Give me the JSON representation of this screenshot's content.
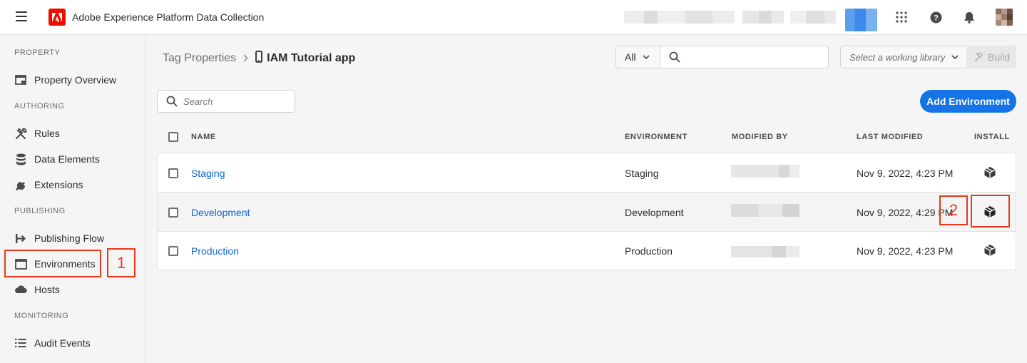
{
  "app": {
    "title": "Adobe Experience Platform Data Collection"
  },
  "sidebar": {
    "sections": [
      {
        "heading": "PROPERTY",
        "items": [
          {
            "label": "Property Overview",
            "icon": "property-overview-icon"
          }
        ]
      },
      {
        "heading": "AUTHORING",
        "items": [
          {
            "label": "Rules",
            "icon": "rules-icon"
          },
          {
            "label": "Data Elements",
            "icon": "data-elements-icon"
          },
          {
            "label": "Extensions",
            "icon": "extensions-icon"
          }
        ]
      },
      {
        "heading": "PUBLISHING",
        "items": [
          {
            "label": "Publishing Flow",
            "icon": "publishing-flow-icon"
          },
          {
            "label": "Environments",
            "icon": "environments-icon"
          },
          {
            "label": "Hosts",
            "icon": "hosts-icon"
          }
        ]
      },
      {
        "heading": "MONITORING",
        "items": [
          {
            "label": "Audit Events",
            "icon": "audit-events-icon"
          }
        ]
      }
    ]
  },
  "breadcrumb": {
    "root": "Tag Properties",
    "current": "IAM Tutorial app"
  },
  "toolbar": {
    "scope": "All",
    "search_placeholder": "",
    "library_placeholder": "Select a working library",
    "build_label": "Build"
  },
  "environments": {
    "search_placeholder": "Search",
    "add_label": "Add Environment",
    "columns": {
      "name": "NAME",
      "environment": "ENVIRONMENT",
      "modified_by": "MODIFIED BY",
      "last_modified": "LAST MODIFIED",
      "install": "INSTALL"
    },
    "rows": [
      {
        "name": "Staging",
        "environment": "Staging",
        "last_modified": "Nov 9, 2022, 4:23 PM"
      },
      {
        "name": "Development",
        "environment": "Development",
        "last_modified": "Nov 9, 2022, 4:29 PM"
      },
      {
        "name": "Production",
        "environment": "Production",
        "last_modified": "Nov 9, 2022, 4:23 PM"
      }
    ]
  },
  "annotations": {
    "first": "1",
    "second": "2"
  },
  "colors": {
    "accent": "#1473e6",
    "brand": "#eb1000",
    "annotation": "#e8391e",
    "link": "#0d66d0"
  }
}
